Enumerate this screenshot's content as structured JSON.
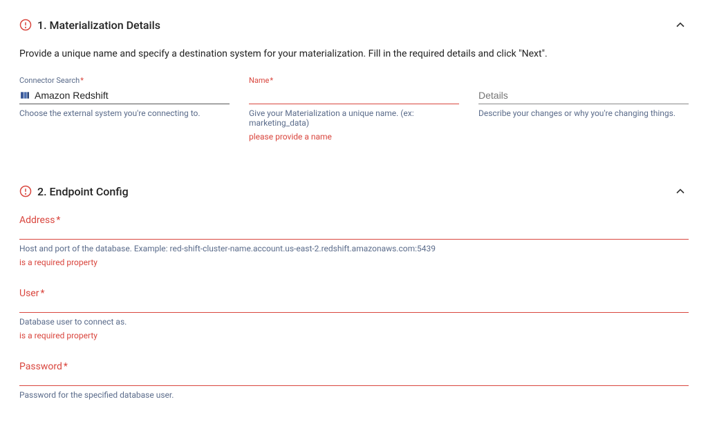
{
  "section1": {
    "title": "1. Materialization Details",
    "instructions": "Provide a unique name and specify a destination system for your materialization. Fill in the required details and click \"Next\".",
    "connector": {
      "label": "Connector Search",
      "asterisk": "*",
      "value": "Amazon Redshift",
      "helper": "Choose the external system you're connecting to."
    },
    "name": {
      "label": "Name",
      "asterisk": "*",
      "value": "",
      "helper": "Give your Materialization a unique name. (ex: marketing_data)",
      "error": "please provide a name"
    },
    "details": {
      "label": "Details",
      "value": "",
      "helper": "Describe your changes or why you're changing things."
    }
  },
  "section2": {
    "title": "2. Endpoint Config",
    "address": {
      "label": "Address",
      "asterisk": "*",
      "helper": "Host and port of the database. Example: red-shift-cluster-name.account.us-east-2.redshift.amazonaws.com:5439",
      "error": "is a required property"
    },
    "user": {
      "label": "User",
      "asterisk": "*",
      "helper": "Database user to connect as.",
      "error": "is a required property"
    },
    "password": {
      "label": "Password",
      "asterisk": "*",
      "helper": "Password for the specified database user."
    }
  }
}
